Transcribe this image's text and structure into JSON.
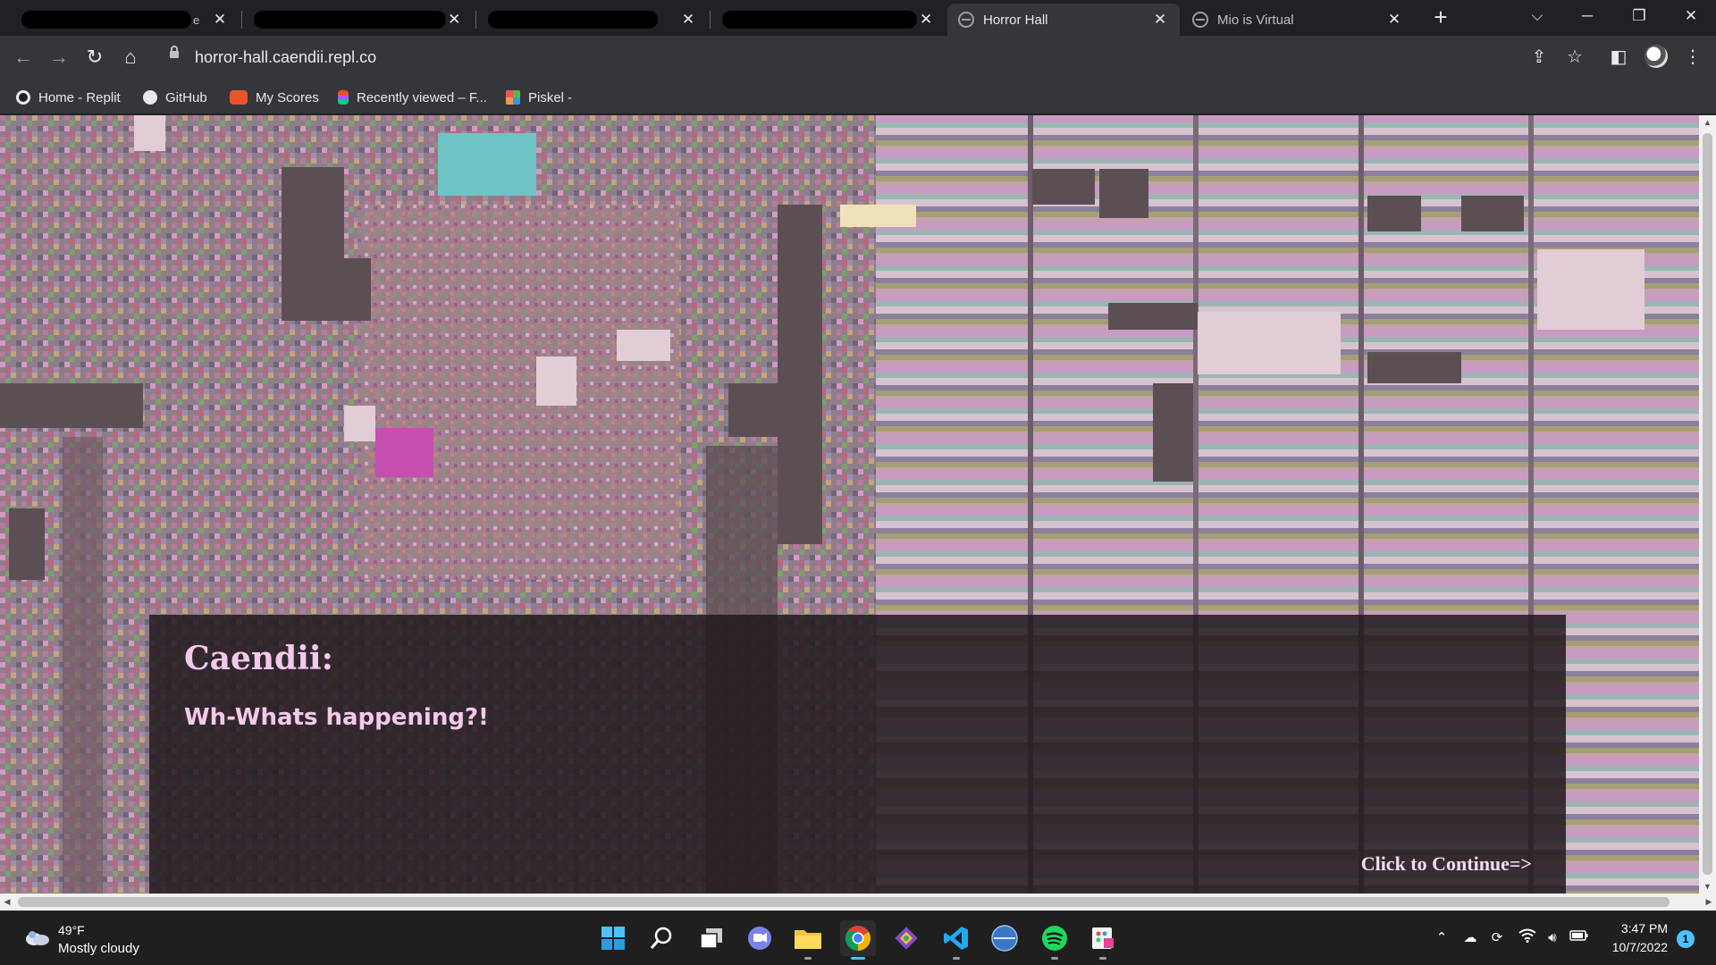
{
  "browser": {
    "tabs": [
      {
        "label": "",
        "redacted": true,
        "suffix": "e",
        "active": false
      },
      {
        "label": "",
        "redacted": true,
        "active": false
      },
      {
        "label": "",
        "redacted": true,
        "active": false
      },
      {
        "label": "",
        "redacted": true,
        "active": false
      },
      {
        "label": "Horror Hall",
        "redacted": false,
        "active": true
      },
      {
        "label": "Mio is Virtual",
        "redacted": false,
        "active": false
      }
    ],
    "new_tab": "+",
    "url": "horror-hall.caendii.repl.co",
    "bookmarks": [
      {
        "label": "Home - Replit",
        "icon": "replit-icon",
        "color": "#e8eaed"
      },
      {
        "label": "GitHub",
        "icon": "github-icon",
        "color": "#e8eaed"
      },
      {
        "label": "My Scores",
        "icon": "scores-icon",
        "color": "#e8542b"
      },
      {
        "label": "Recently viewed – F...",
        "icon": "figma-icon",
        "color": "#f24e1e"
      },
      {
        "label": "Piskel -",
        "icon": "piskel-icon",
        "color": "#58b548"
      }
    ]
  },
  "game": {
    "speaker": "Caendii:",
    "dialogue": "Wh-Whats happening?!",
    "continue_label": "Click to Continue=>",
    "text_color": "#f4c9ec"
  },
  "taskbar": {
    "weather": {
      "temp": "49°F",
      "condition": "Mostly cloudy"
    },
    "apps": [
      {
        "name": "start-button",
        "icon": "windows-icon"
      },
      {
        "name": "search-button",
        "icon": "search-icon"
      },
      {
        "name": "task-view-button",
        "icon": "task-view-icon"
      },
      {
        "name": "teams-chat-button",
        "icon": "chat-icon"
      },
      {
        "name": "file-explorer-button",
        "icon": "folder-icon"
      },
      {
        "name": "chrome-button",
        "icon": "chrome-icon",
        "active": true
      },
      {
        "name": "git-app-button",
        "icon": "git-icon"
      },
      {
        "name": "vscode-button",
        "icon": "vscode-icon"
      },
      {
        "name": "browser-app-button",
        "icon": "globe-icon"
      },
      {
        "name": "spotify-button",
        "icon": "spotify-icon"
      },
      {
        "name": "paint-app-button",
        "icon": "paint-icon"
      }
    ],
    "time": "3:47 PM",
    "date": "10/7/2022",
    "notifications": "1"
  }
}
